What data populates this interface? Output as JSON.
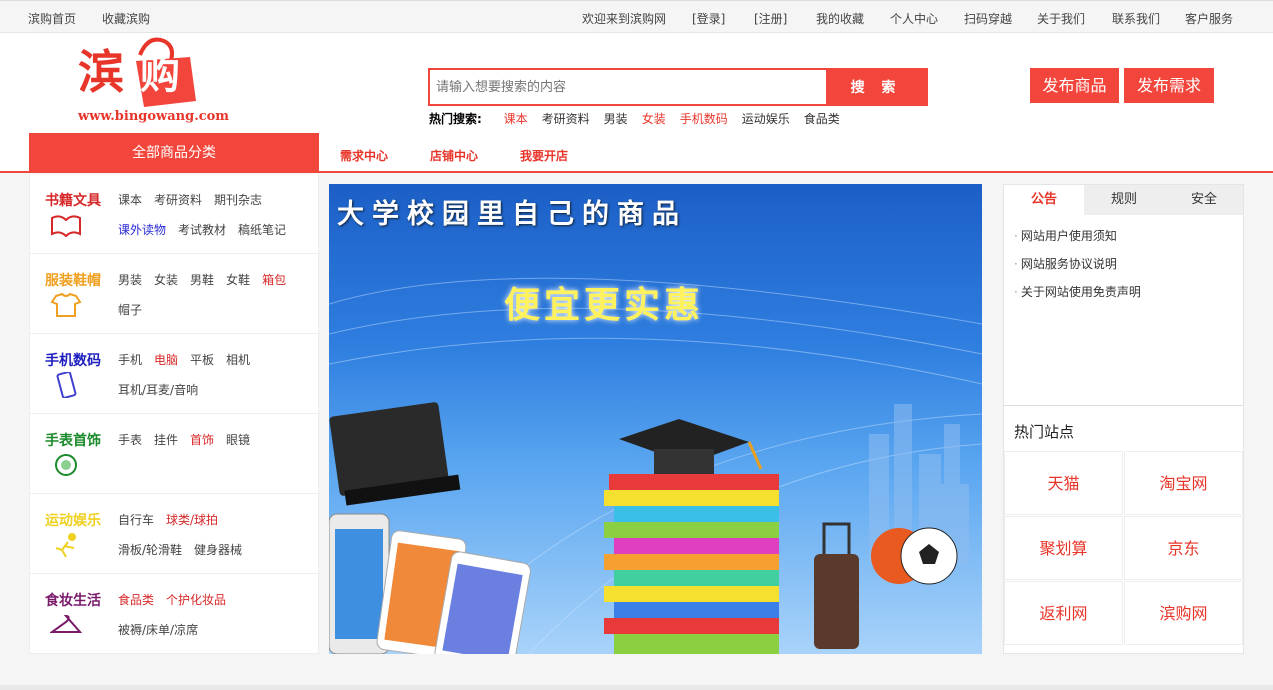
{
  "topbar": {
    "home": "滨购首页",
    "fav_site": "收藏滨购",
    "welcome": "欢迎来到滨购网",
    "login": "[登录]",
    "register": "[注册]",
    "my_fav": "我的收藏",
    "personal": "个人中心",
    "scan": "扫码穿越",
    "about": "关于我们",
    "contact": "联系我们",
    "service": "客户服务"
  },
  "logo": {
    "text": "滨购",
    "url": "www.bingowang.com",
    "color": "#e8352a"
  },
  "search": {
    "placeholder": "请输入想要搜索的内容",
    "button": "搜 索",
    "hot_label": "热门搜索:",
    "hot_keywords": [
      {
        "text": "课本",
        "color": "#e8352a"
      },
      {
        "text": "考研资料",
        "color": "#333333"
      },
      {
        "text": "男装",
        "color": "#333333"
      },
      {
        "text": "女装",
        "color": "#e8352a"
      },
      {
        "text": "手机数码",
        "color": "#e8352a"
      },
      {
        "text": "运动娱乐",
        "color": "#333333"
      },
      {
        "text": "食品类",
        "color": "#333333"
      }
    ]
  },
  "actions": {
    "publish_goods": "发布商品",
    "publish_demand": "发布需求"
  },
  "nav": {
    "all_categories": "全部商品分类",
    "links": [
      "需求中心",
      "店铺中心",
      "我要开店"
    ]
  },
  "categories": [
    {
      "title": "书籍文具",
      "title_color": "#d62828",
      "icon": "book-icon",
      "rows": [
        [
          {
            "t": "课本",
            "c": "#444"
          },
          {
            "t": "考研资料",
            "c": "#444"
          },
          {
            "t": "期刊杂志",
            "c": "#444"
          }
        ],
        [
          {
            "t": "课外读物",
            "c": "#2a2ad6"
          },
          {
            "t": "考试教材",
            "c": "#444"
          },
          {
            "t": "稿纸笔记",
            "c": "#444"
          }
        ]
      ]
    },
    {
      "title": "服装鞋帽",
      "title_color": "#f0a020",
      "icon": "tshirt-icon",
      "rows": [
        [
          {
            "t": "男装",
            "c": "#444"
          },
          {
            "t": "女装",
            "c": "#444"
          },
          {
            "t": "男鞋",
            "c": "#444"
          },
          {
            "t": "女鞋",
            "c": "#444"
          },
          {
            "t": "箱包",
            "c": "#d62828"
          }
        ],
        [
          {
            "t": "帽子",
            "c": "#444"
          }
        ]
      ]
    },
    {
      "title": "手机数码",
      "title_color": "#2020c0",
      "icon": "phone-icon",
      "rows": [
        [
          {
            "t": "手机",
            "c": "#444"
          },
          {
            "t": "电脑",
            "c": "#d62828"
          },
          {
            "t": "平板",
            "c": "#444"
          },
          {
            "t": "相机",
            "c": "#444"
          }
        ],
        [
          {
            "t": "耳机/耳麦/音响",
            "c": "#444"
          }
        ]
      ]
    },
    {
      "title": "手表首饰",
      "title_color": "#1a8a2a",
      "icon": "watch-icon",
      "rows": [
        [
          {
            "t": "手表",
            "c": "#444"
          },
          {
            "t": "挂件",
            "c": "#444"
          },
          {
            "t": "首饰",
            "c": "#d62828"
          },
          {
            "t": "眼镜",
            "c": "#444"
          }
        ]
      ]
    },
    {
      "title": "运动娱乐",
      "title_color": "#f0d020",
      "icon": "sports-icon",
      "rows": [
        [
          {
            "t": "自行车",
            "c": "#444"
          },
          {
            "t": "球类/球拍",
            "c": "#d62828"
          }
        ],
        [
          {
            "t": "滑板/轮滑鞋",
            "c": "#444"
          },
          {
            "t": "健身器械",
            "c": "#444"
          }
        ]
      ]
    },
    {
      "title": "食妆生活",
      "title_color": "#7a1a6a",
      "icon": "hanger-icon",
      "rows": [
        [
          {
            "t": "食品类",
            "c": "#d62828"
          },
          {
            "t": "个护化妆品",
            "c": "#d62828"
          }
        ],
        [
          {
            "t": "被褥/床单/凉席",
            "c": "#444"
          }
        ]
      ]
    }
  ],
  "banner": {
    "title": "大学校园里自己的商品",
    "subtitle": "便宜更实惠"
  },
  "notice_panel": {
    "tabs": [
      "公告",
      "规则",
      "安全"
    ],
    "items": [
      "网站用户使用须知",
      "网站服务协议说明",
      "关于网站使用免责声明"
    ]
  },
  "hot_sites": {
    "title": "热门站点",
    "sites": [
      "天猫",
      "淘宝网",
      "聚划算",
      "京东",
      "返利网",
      "滨购网"
    ]
  }
}
